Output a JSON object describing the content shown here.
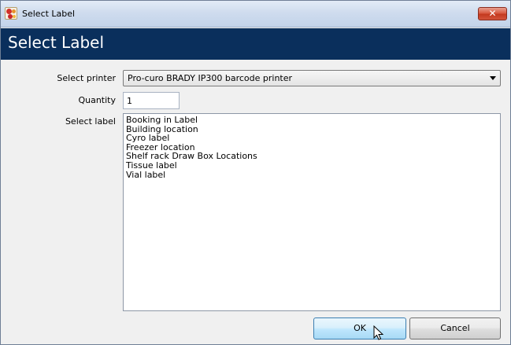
{
  "window": {
    "title": "Select Label",
    "close_glyph": "✕",
    "icon": "app-logo-icon"
  },
  "header": {
    "title": "Select Label"
  },
  "form": {
    "printer_label": "Select printer",
    "printer_value": "Pro-curo BRADY IP300 barcode printer",
    "quantity_label": "Quantity",
    "quantity_value": "1",
    "label_label": "Select label",
    "labels": [
      "Booking in Label",
      "Building location",
      "Cyro label",
      "Freezer location",
      "Shelf rack Draw Box Locations",
      "Tissue label",
      "Vial label"
    ]
  },
  "buttons": {
    "ok": "OK",
    "cancel": "Cancel"
  },
  "colors": {
    "header_band": "#0a2f5c",
    "ok_border": "#3c7fb1",
    "close_button": "#c43a1f"
  }
}
